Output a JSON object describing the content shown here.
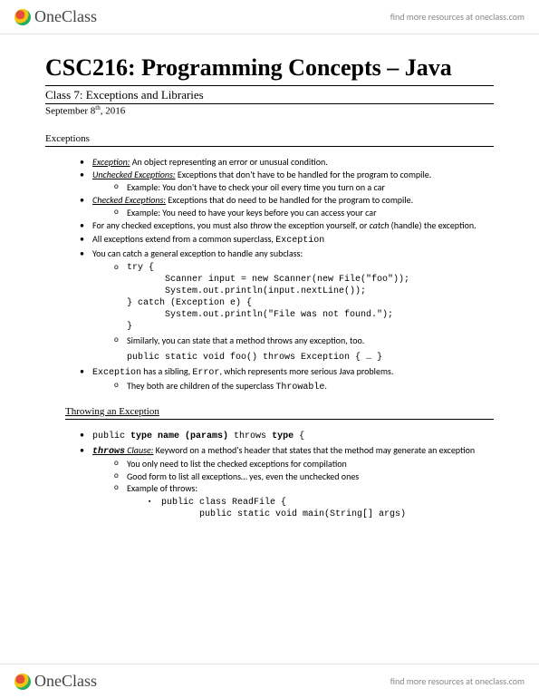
{
  "brand": {
    "one": "One",
    "class": "Class",
    "tagline": "find more resources at oneclass.com"
  },
  "doc": {
    "title": "CSC216: Programming Concepts – Java",
    "class_title": "Class 7: Exceptions and Libraries",
    "date_prefix": "September 8",
    "date_suffix": "th",
    "date_year": ", 2016"
  },
  "sections": {
    "exceptions": "Exceptions",
    "throwing": "Throwing an Exception"
  },
  "ex": {
    "b1_term": "Exception:",
    "b1_text": " An object representing an error or unusual condition.",
    "b2_term": "Unchecked Exceptions:",
    "b2_text": " Exceptions that don't have to be handled for the program to compile.",
    "b2_ex": "Example: You don't have to check your oil every time you turn on a car",
    "b3_term": "Checked Exceptions:",
    "b3_text": " Exceptions that do need to be handled for the program to compile.",
    "b3_ex": "Example: You need to have your keys before you can access your car",
    "b4_pre": "For any checked exceptions, you must also ",
    "b4_throw": "throw",
    "b4_mid": " the exception yourself, or ",
    "b4_catch": "catch",
    "b4_post": " (handle) the exception.",
    "b5_pre": "All exceptions extend from a common superclass, ",
    "b5_code": "Exception",
    "b6": "You can catch a general exception to handle any subclass:",
    "b6_code": "try {\n       Scanner input = new Scanner(new File(\"foo\"));\n       System.out.println(input.nextLine());\n} catch (Exception e) {\n       System.out.println(\"File was not found.\");\n}",
    "b6_sim": "Similarly, you can state that a method throws any exception, too.",
    "b6_code2": "public static void foo() throws Exception { … }",
    "b7_code1": "Exception",
    "b7_mid1": " has a sibling, ",
    "b7_code2": "Error",
    "b7_mid2": ", which represents more serious Java problems.",
    "b7_sub_pre": "They both are children of the superclass ",
    "b7_sub_code": "Throwable",
    "b7_sub_post": "."
  },
  "throw": {
    "b1_code": "public type name (params) throws type {",
    "b2_term": "throws",
    "b2_term2": " Clause:",
    "b2_text": " Keyword on a method's header that states that the method may generate an exception",
    "b2_s1": "You only need to list the checked exceptions for compilation",
    "b2_s2": "Good form to list all exceptions… yes, even the unchecked ones",
    "b2_s3": "Example of throws:",
    "b2_code": "public class ReadFile {\n       public static void main(String[] args)"
  }
}
